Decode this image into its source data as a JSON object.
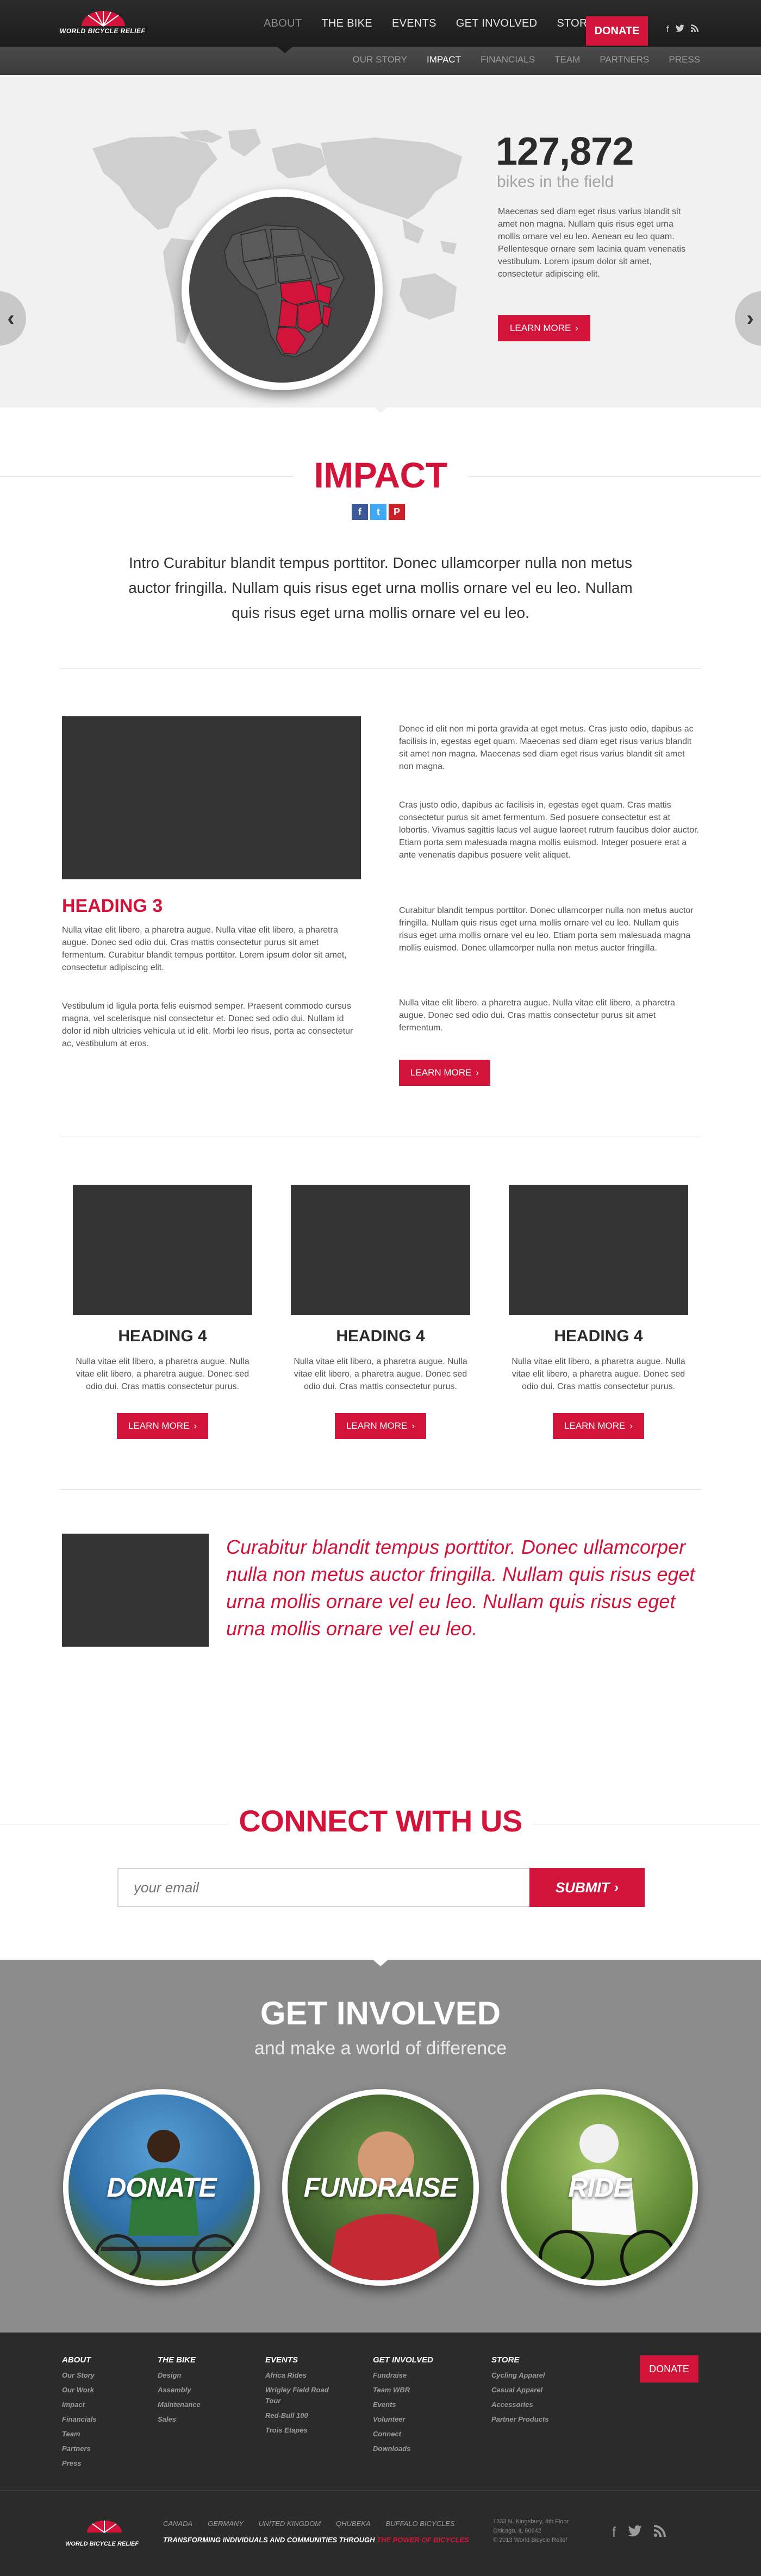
{
  "brand": {
    "name": "WORLD BICYCLE RELIEF",
    "accent": "#d3143a"
  },
  "nav": {
    "items": [
      {
        "label": "ABOUT",
        "active": true
      },
      {
        "label": "THE BIKE"
      },
      {
        "label": "EVENTS"
      },
      {
        "label": "GET INVOLVED"
      },
      {
        "label": "STORE"
      }
    ],
    "donate": "DONATE",
    "social": [
      "f",
      "t",
      "rss"
    ]
  },
  "subnav": {
    "items": [
      {
        "label": "OUR STORY"
      },
      {
        "label": "IMPACT",
        "active": true
      },
      {
        "label": "FINANCIALS"
      },
      {
        "label": "TEAM"
      },
      {
        "label": "PARTNERS"
      },
      {
        "label": "PRESS"
      }
    ]
  },
  "hero": {
    "stat": "127,872",
    "stat_label": "bikes in the field",
    "body": "Maecenas sed diam eget risus varius blandit sit amet non magna. Nullam quis risus eget urna mollis ornare vel eu leo. Aenean eu leo quam. Pellentesque ornare sem lacinia quam venenatis vestibulum. Lorem ipsum dolor sit amet, consectetur adipiscing elit.",
    "button": "LEARN MORE",
    "prev_icon": "chevron-left-icon",
    "next_icon": "chevron-right-icon"
  },
  "impact": {
    "title": "IMPACT",
    "share": [
      "f",
      "t",
      "P"
    ],
    "intro": "Intro Curabitur blandit tempus porttitor. Donec ullamcorper nulla non metus auctor fringilla. Nullam quis risus eget urna mollis ornare vel eu leo. Nullam quis risus eget urna mollis ornare vel eu leo."
  },
  "section3": {
    "heading": "HEADING 3",
    "left_p1": "Nulla vitae elit libero, a pharetra augue. Nulla vitae elit libero, a pharetra augue. Donec sed odio dui. Cras mattis consectetur purus sit amet fermentum. Curabitur blandit tempus porttitor. Lorem ipsum dolor sit amet, consectetur adipiscing elit.",
    "left_p2": "Vestibulum id ligula porta felis euismod semper. Praesent commodo cursus magna, vel scelerisque nisl consectetur et. Donec sed odio dui. Nullam id dolor id nibh ultricies vehicula ut id elit. Morbi leo risus, porta ac consectetur ac, vestibulum at eros.",
    "right_p1": "Donec id elit non mi porta gravida at eget metus. Cras justo odio, dapibus ac facilisis in, egestas eget quam. Maecenas sed diam eget risus varius blandit sit amet non magna. Maecenas sed diam eget risus varius blandit sit amet non magna.",
    "right_p2": "Cras justo odio, dapibus ac facilisis in, egestas eget quam. Cras mattis consectetur purus sit amet fermentum. Sed posuere consectetur est at lobortis. Vivamus sagittis lacus vel augue laoreet rutrum faucibus dolor auctor. Etiam porta sem malesuada magna mollis euismod. Integer posuere erat a ante venenatis dapibus posuere velit aliquet.",
    "right_p3": "Curabitur blandit tempus porttitor. Donec ullamcorper nulla non metus auctor fringilla. Nullam quis risus eget urna mollis ornare vel eu leo. Nullam quis risus eget urna mollis ornare vel eu leo. Etiam porta sem malesuada magna mollis euismod. Donec ullamcorper nulla non metus auctor fringilla.",
    "right_p4": "Nulla vitae elit libero, a pharetra augue. Nulla vitae elit libero, a pharetra augue. Donec sed odio dui. Cras mattis consectetur purus sit amet fermentum.",
    "button": "LEARN MORE"
  },
  "cards": [
    {
      "heading": "HEADING 4",
      "text": "Nulla vitae elit libero, a pharetra augue. Nulla vitae elit libero, a pharetra augue. Donec sed odio dui. Cras mattis consectetur purus.",
      "button": "LEARN MORE"
    },
    {
      "heading": "HEADING 4",
      "text": "Nulla vitae elit libero, a pharetra augue. Nulla vitae elit libero, a pharetra augue. Donec sed odio dui. Cras mattis consectetur purus.",
      "button": "LEARN MORE"
    },
    {
      "heading": "HEADING 4",
      "text": "Nulla vitae elit libero, a pharetra augue. Nulla vitae elit libero, a pharetra augue. Donec sed odio dui. Cras mattis consectetur purus.",
      "button": "LEARN MORE"
    }
  ],
  "quote": "Curabitur blandit tempus porttitor. Donec ullamcorper nulla non metus auctor fringilla. Nullam quis risus eget urna mollis ornare vel eu leo. Nullam quis risus eget urna mollis ornare vel eu leo.",
  "connect": {
    "title": "CONNECT WITH US",
    "placeholder": "your email",
    "submit": "SUBMIT"
  },
  "involved": {
    "title": "GET INVOLVED",
    "subtitle": "and make a world of difference",
    "items": [
      {
        "label": "DONATE"
      },
      {
        "label": "FUNDRAISE"
      },
      {
        "label": "RIDE"
      }
    ]
  },
  "footer": {
    "columns": [
      {
        "title": "ABOUT",
        "links": [
          "Our Story",
          "Our Work",
          "Impact",
          "Financials",
          "Team",
          "Partners",
          "Press"
        ]
      },
      {
        "title": "THE BIKE",
        "links": [
          "Design",
          "Assembly",
          "Maintenance",
          "Sales"
        ]
      },
      {
        "title": "EVENTS",
        "links": [
          "Africa Rides",
          "Wrigley Field Road Tour",
          "Red-Bull 100",
          "Trois Etapes"
        ]
      },
      {
        "title": "GET INVOLVED",
        "links": [
          "Fundraise",
          "Team WBR",
          "Events",
          "Volunteer",
          "Connect",
          "Downloads"
        ]
      },
      {
        "title": "STORE",
        "links": [
          "Cycling Apparel",
          "Casual Apparel",
          "Accessories",
          "Partner Products"
        ]
      }
    ],
    "donate": "DONATE",
    "regions": [
      "CANADA",
      "GERMANY",
      "UNITED KINGDOM",
      "QHUBEKA",
      "BUFFALO BICYCLES"
    ],
    "tagline_prefix": "TRANSFORMING INDIVIDUALS AND COMMUNITIES THROUGH",
    "tagline_suffix": "THE POWER OF BICYCLES",
    "address_line1": "1333 N. Kingsbury, 4th Floor",
    "address_line2": "Chicago, IL 60642",
    "address_line3": "© 2013 World Bicycle Relief"
  }
}
